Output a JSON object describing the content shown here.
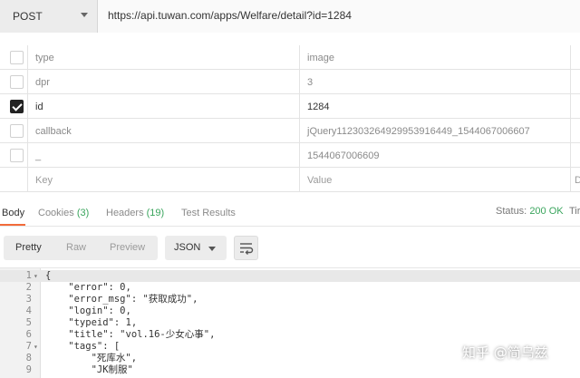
{
  "request": {
    "method": "POST",
    "url": "https://api.tuwan.com/apps/Welfare/detail?id=1284"
  },
  "params": {
    "rows": [
      {
        "key": "type",
        "value": "image",
        "checked": false
      },
      {
        "key": "dpr",
        "value": "3",
        "checked": false
      },
      {
        "key": "id",
        "value": "1284",
        "checked": true
      },
      {
        "key": "callback",
        "value": "jQuery112303264929953916449_1544067006607",
        "checked": false
      },
      {
        "key": "_",
        "value": "1544067006609",
        "checked": false
      }
    ],
    "placeholder_key": "Key",
    "placeholder_value": "Value",
    "desc_header": "D"
  },
  "response_tabs": {
    "body": "Body",
    "cookies": "Cookies",
    "cookies_count": "(3)",
    "headers": "Headers",
    "headers_count": "(19)",
    "test_results": "Test Results",
    "status_label": "Status:",
    "status_value": "200 OK",
    "time_label": "Tir"
  },
  "toolbar": {
    "pretty": "Pretty",
    "raw": "Raw",
    "preview": "Preview",
    "format": "JSON"
  },
  "code_lines": [
    {
      "num": "1",
      "fold": "▾",
      "text": "{"
    },
    {
      "num": "2",
      "fold": "",
      "text": "    \"error\": 0,"
    },
    {
      "num": "3",
      "fold": "",
      "text": "    \"error_msg\": \"获取成功\","
    },
    {
      "num": "4",
      "fold": "",
      "text": "    \"login\": 0,"
    },
    {
      "num": "5",
      "fold": "",
      "text": "    \"typeid\": 1,"
    },
    {
      "num": "6",
      "fold": "",
      "text": "    \"title\": \"vol.16-少女心事\","
    },
    {
      "num": "7",
      "fold": "▾",
      "text": "    \"tags\": ["
    },
    {
      "num": "8",
      "fold": "",
      "text": "        \"死库水\","
    },
    {
      "num": "9",
      "fold": "",
      "text": "        \"JK制服\""
    }
  ],
  "watermark": "知乎 @简乌兹",
  "colors": {
    "accent": "#f26b3a",
    "success": "#3aa55d",
    "checkbox_checked": "#222222"
  },
  "icons": {
    "method_dropdown": "chevron-down-icon",
    "format_dropdown": "chevron-down-icon",
    "wrap": "wrap-lines-icon",
    "checkbox": "checkbox-icon"
  }
}
